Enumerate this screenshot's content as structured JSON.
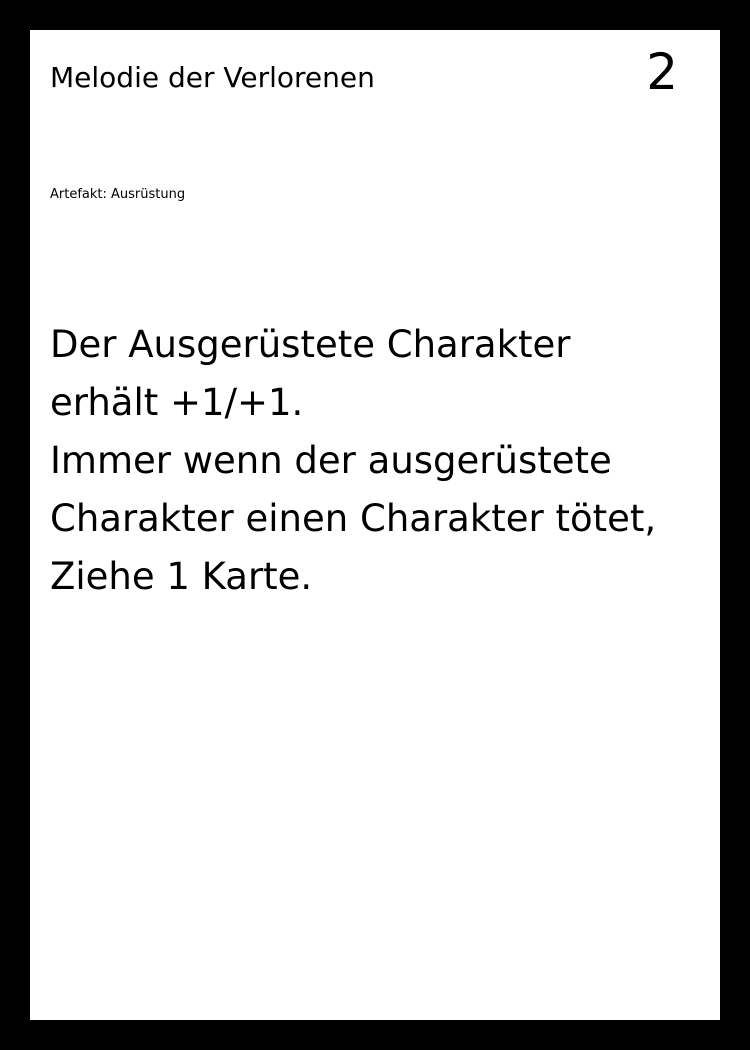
{
  "card": {
    "title": "Melodie der Verlorenen",
    "cost": "2",
    "type_line": "Artefakt: Ausrüstung",
    "rules_lines": [
      "Der Ausgerüstete Charakter",
      "erhält +1/+1.",
      "Immer wenn der ausgerüstete",
      "Charakter einen Charakter tötet,",
      "Ziehe 1 Karte."
    ]
  },
  "colors": {
    "border": "#000000",
    "card_background": "#ffffff",
    "text": "#000000"
  }
}
